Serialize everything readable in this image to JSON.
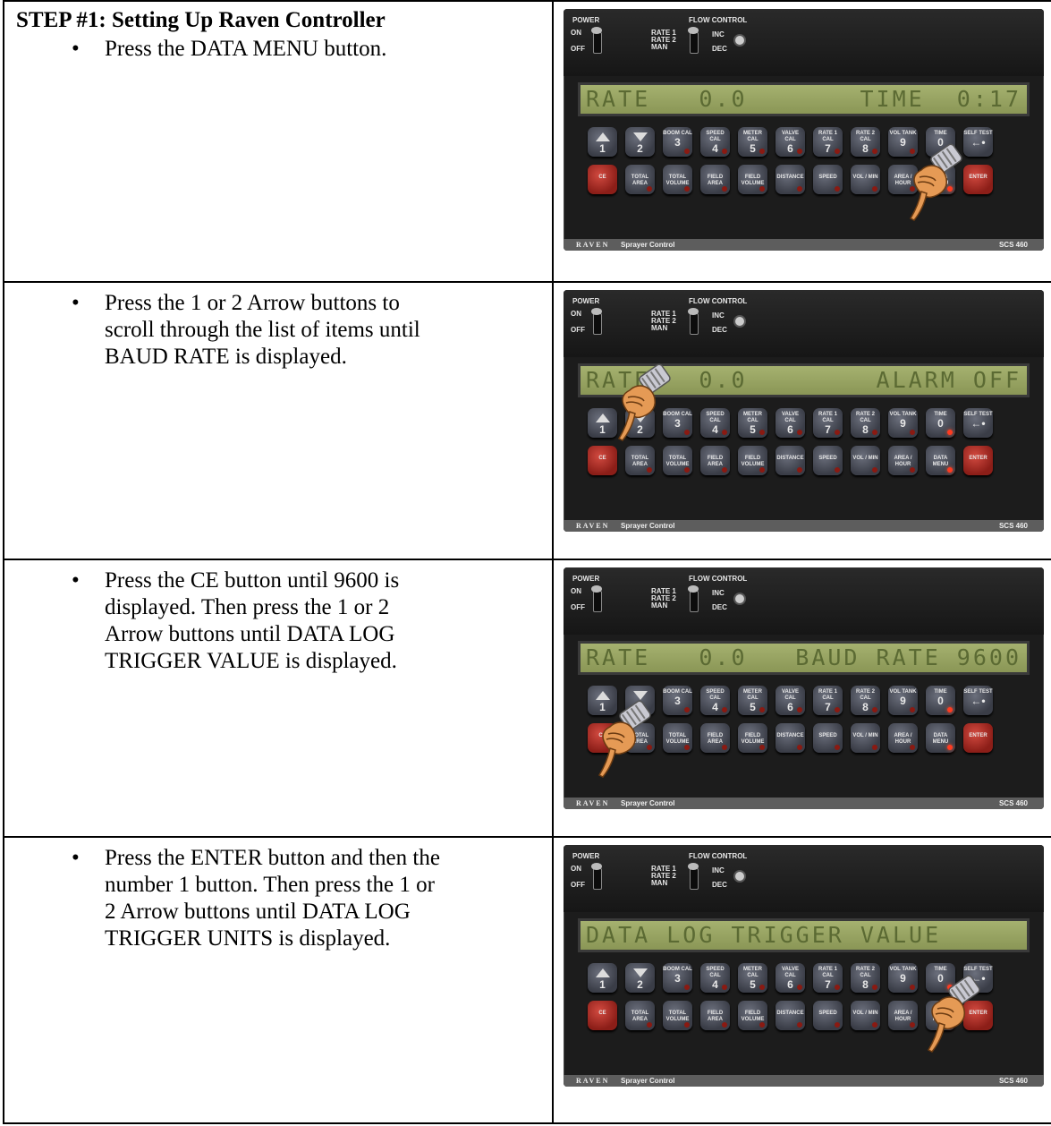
{
  "heading": "STEP #1:  Setting Up Raven Controller",
  "bullet_glyph": "•",
  "rows": [
    {
      "lines": [
        "Press the DATA MENU button."
      ],
      "display": {
        "left": "RATE   0.0",
        "right": "TIME  0:17"
      },
      "hand": "data-menu"
    },
    {
      "lines": [
        "Press the 1 or 2 Arrow buttons to",
        "scroll through the list of items until",
        "BAUD RATE is displayed."
      ],
      "display": {
        "left": "RATE   0.0",
        "right": "ALARM OFF"
      },
      "hand": "arrow"
    },
    {
      "lines": [
        "Press the CE button until 9600 is",
        "displayed.  Then press the 1 or 2",
        "Arrow buttons until DATA LOG",
        "TRIGGER VALUE is displayed."
      ],
      "display": {
        "left": "RATE   0.0",
        "right": "BAUD RATE 9600"
      },
      "hand": "ce"
    },
    {
      "lines": [
        "Press the ENTER button and then the",
        "number 1 button.  Then press the 1 or",
        "2 Arrow buttons until DATA LOG",
        "TRIGGER UNITS is displayed."
      ],
      "display": {
        "left": "DATA LOG TRIGGER VALUE",
        "right": ""
      },
      "hand": "enter"
    }
  ],
  "panel": {
    "power_label": "POWER",
    "on_label": "ON",
    "off_label": "OFF",
    "flow_label": "FLOW  CONTROL",
    "rate1_label": "RATE 1",
    "rate2_label": "RATE 2",
    "man_label": "MAN",
    "inc_label": "INC",
    "dec_label": "DEC",
    "brand": "RAVEN",
    "product_bold": "Sprayer",
    "product_rest": "Control",
    "model": "SCS 460",
    "top_keys": [
      {
        "l1": "",
        "n": "1",
        "icon": "up-arrow"
      },
      {
        "l1": "",
        "n": "2",
        "icon": "down-arrow"
      },
      {
        "l1": "BOOM CAL",
        "n": "3"
      },
      {
        "l1": "SPEED CAL",
        "n": "4"
      },
      {
        "l1": "METER CAL",
        "n": "5"
      },
      {
        "l1": "VALVE CAL",
        "n": "6"
      },
      {
        "l1": "RATE 1 CAL",
        "n": "7"
      },
      {
        "l1": "RATE 2 CAL",
        "n": "8"
      },
      {
        "l1": "VOL TANK",
        "n": "9"
      },
      {
        "l1": "TIME",
        "n": "0"
      },
      {
        "l1": "SELF TEST",
        "n": "←•"
      }
    ],
    "bottom_keys": [
      {
        "l1": "CE"
      },
      {
        "l1": "TOTAL AREA"
      },
      {
        "l1": "TOTAL VOLUME"
      },
      {
        "l1": "FIELD AREA"
      },
      {
        "l1": "FIELD VOLUME"
      },
      {
        "l1": "DISTANCE"
      },
      {
        "l1": "SPEED"
      },
      {
        "l1": "VOL / MIN"
      },
      {
        "l1": "AREA / HOUR"
      },
      {
        "l1": "DATA MENU"
      },
      {
        "l1": "ENTER"
      }
    ]
  }
}
